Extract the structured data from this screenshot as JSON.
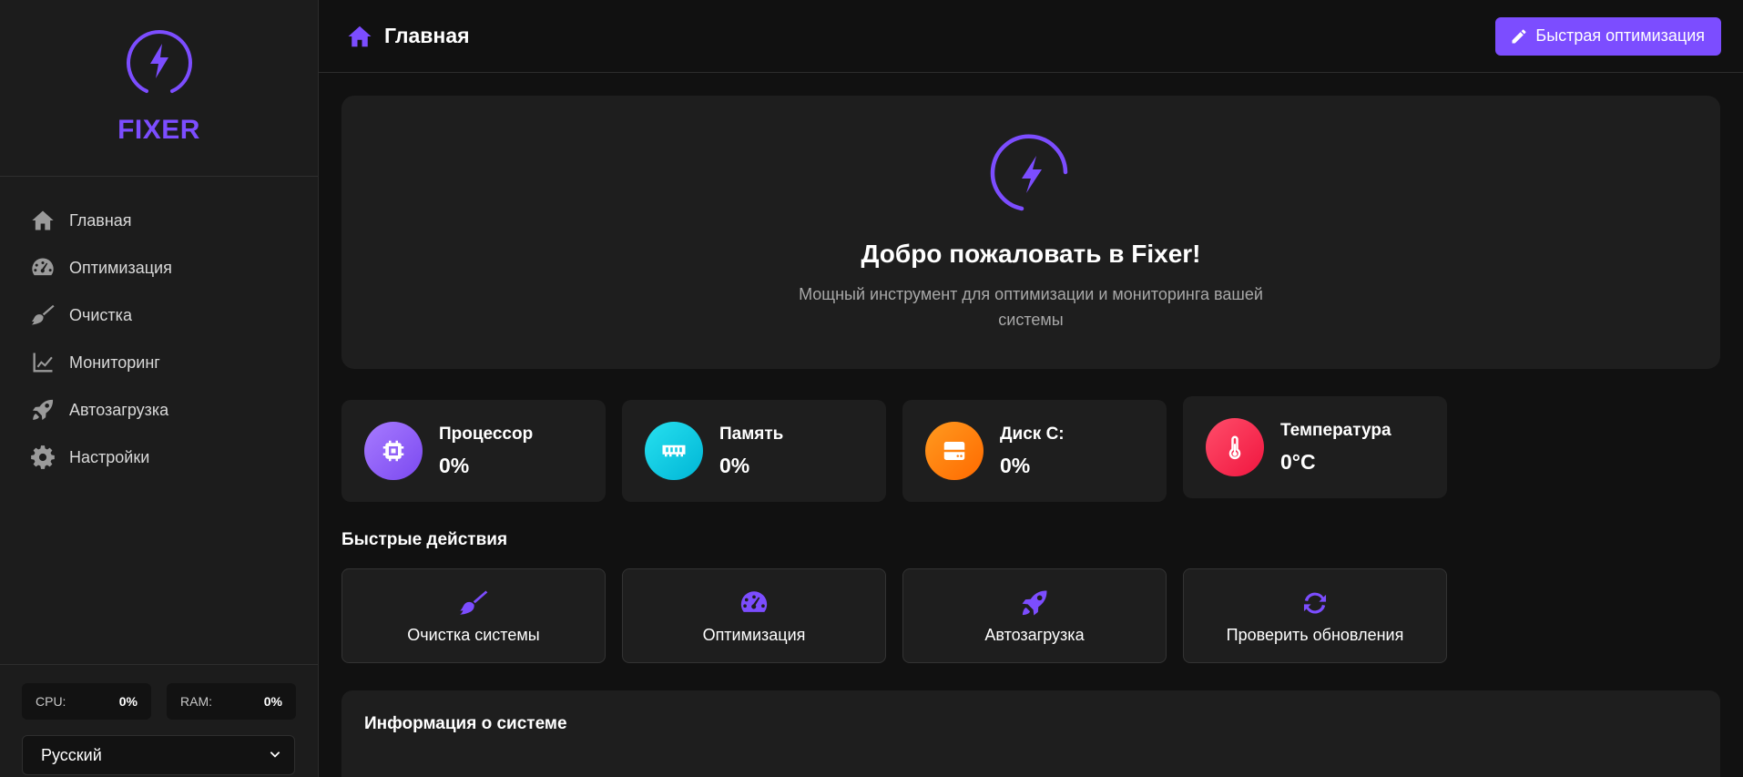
{
  "sidebar": {
    "brand": "FIXER",
    "items": [
      {
        "label": "Главная",
        "icon": "home-icon"
      },
      {
        "label": "Оптимизация",
        "icon": "gauge-icon"
      },
      {
        "label": "Очистка",
        "icon": "broom-icon"
      },
      {
        "label": "Мониторинг",
        "icon": "chart-line-icon"
      },
      {
        "label": "Автозагрузка",
        "icon": "rocket-icon"
      },
      {
        "label": "Настройки",
        "icon": "gear-icon"
      }
    ],
    "cpu_label": "CPU:",
    "cpu_value": "0%",
    "ram_label": "RAM:",
    "ram_value": "0%",
    "language": "Русский"
  },
  "header": {
    "title": "Главная",
    "quick_button": "Быстрая оптимизация"
  },
  "hero": {
    "title": "Добро пожаловать в Fixer!",
    "subtitle": "Мощный инструмент для оптимизации и мониторинга вашей системы"
  },
  "stats": [
    {
      "label": "Процессор",
      "value": "0%",
      "color": "#8b5cf6",
      "icon": "cpu-icon"
    },
    {
      "label": "Память",
      "value": "0%",
      "color": "#06c8e0",
      "icon": "memory-icon"
    },
    {
      "label": "Диск C:",
      "value": "0%",
      "color": "#ff7a00",
      "icon": "hdd-icon"
    },
    {
      "label": "Температура",
      "value": "0°C",
      "color": "#ff2d55",
      "icon": "thermometer-icon"
    }
  ],
  "quick_actions": {
    "title": "Быстрые действия",
    "items": [
      {
        "label": "Очистка системы",
        "icon": "broom-icon"
      },
      {
        "label": "Оптимизация",
        "icon": "gauge-icon"
      },
      {
        "label": "Автозагрузка",
        "icon": "rocket-icon"
      },
      {
        "label": "Проверить обновления",
        "icon": "sync-icon"
      }
    ]
  },
  "system_info": {
    "title": "Информация о системе"
  },
  "colors": {
    "accent": "#7c4dff",
    "background": "#111111",
    "panel": "#1e1e1e"
  }
}
